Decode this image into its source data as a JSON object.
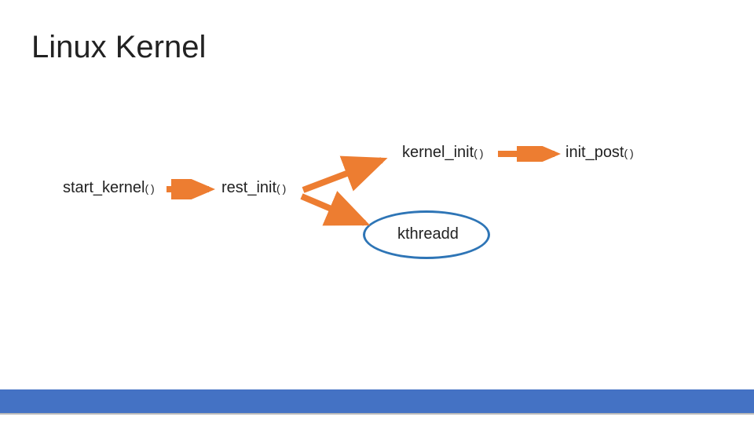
{
  "title": "Linux Kernel",
  "nodes": {
    "start_kernel": "start_kernel",
    "rest_init": "rest_init",
    "kernel_init": "kernel_init",
    "init_post": "init_post",
    "kthreadd": "kthreadd"
  },
  "paren": "( )",
  "arrow_color": "#ed7d31",
  "ellipse_color": "#2e75b6"
}
